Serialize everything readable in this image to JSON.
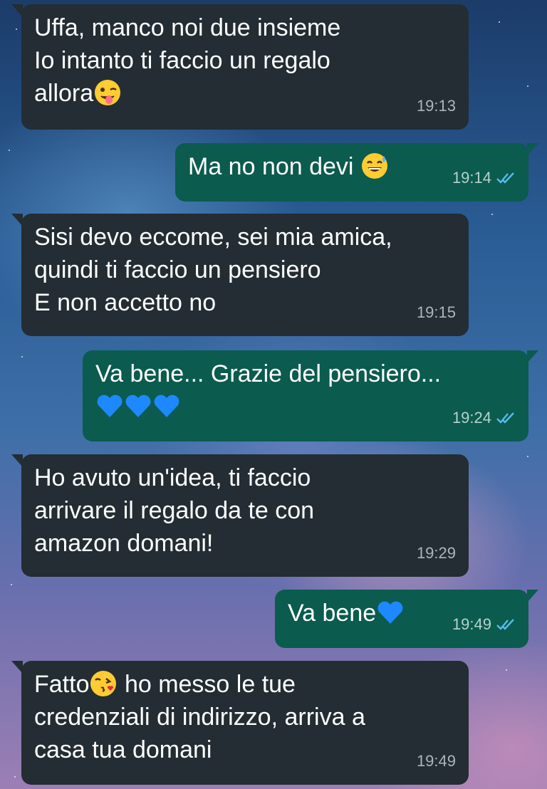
{
  "messages": [
    {
      "dir": "in",
      "lines": [
        "Uffa, manco noi due insieme",
        "Io intanto ti faccio un regalo",
        "allora"
      ],
      "emoji_after_last": "winking-tongue-emoji",
      "time": "19:13"
    },
    {
      "dir": "out",
      "lines": [
        "Ma no non devi"
      ],
      "emoji_after_last": "sweat-smile-emoji",
      "time": "19:14",
      "status": "read"
    },
    {
      "dir": "in",
      "lines": [
        "Sisi devo eccome, sei mia amica,",
        "quindi ti faccio un pensiero",
        "E non accetto no"
      ],
      "time": "19:15"
    },
    {
      "dir": "out",
      "lines": [
        "Va bene... Grazie del pensiero..."
      ],
      "hearts": 3,
      "time": "19:24",
      "status": "read"
    },
    {
      "dir": "in",
      "lines": [
        "Ho avuto un'idea, ti faccio",
        "arrivare il regalo da te con",
        "amazon domani!"
      ],
      "time": "19:29"
    },
    {
      "dir": "out",
      "lines": [
        "Va bene"
      ],
      "emoji_after_last": "blue-heart-emoji",
      "time": "19:49",
      "status": "read"
    },
    {
      "dir": "in",
      "lines": [
        "Fatto",
        "ho messo le tue",
        "credenziali di indirizzo, arriva a",
        "casa tua domani"
      ],
      "time": "19:49"
    }
  ],
  "colors": {
    "incoming": "#232d33",
    "outgoing": "#0b5b4e",
    "read_ticks": "#53bdeb"
  }
}
